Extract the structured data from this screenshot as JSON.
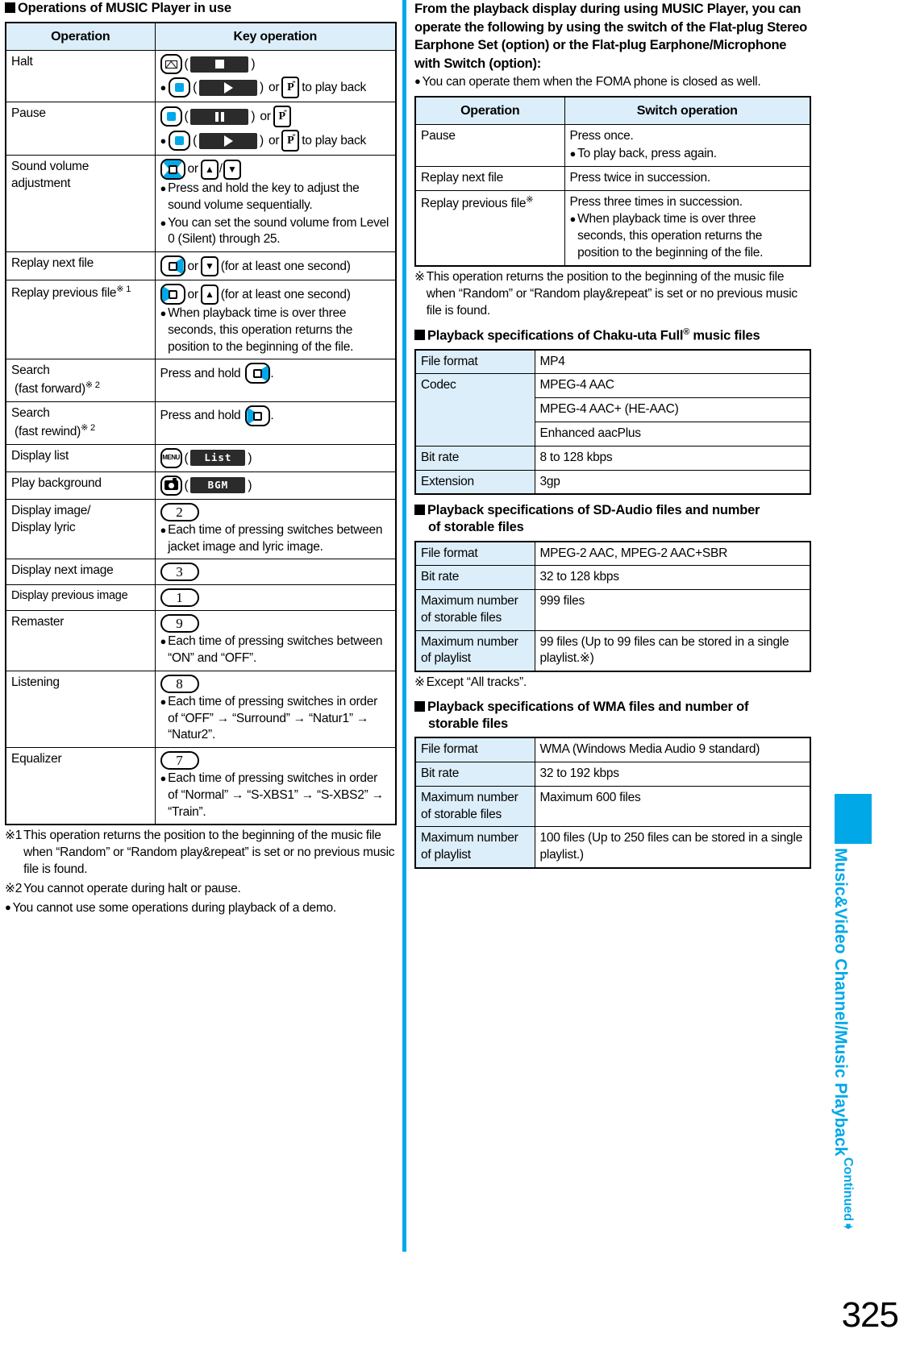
{
  "page": {
    "number": "325",
    "vertical_title": "Music&Video Channel/Music Playback",
    "continued_label": "Continued",
    "continued_arrow": "➧",
    "accent_color": "#00A8E8",
    "table_header_fill": "#DCEEF9"
  },
  "left": {
    "heading": "Operations of MUSIC Player in use",
    "table": {
      "headers": [
        "Operation",
        "Key operation"
      ],
      "rows": [
        {
          "operation": "Halt",
          "lines": [
            {
              "type": "keys",
              "items": [
                "key-mail",
                "paren-open",
                "chip-stop",
                "paren-close"
              ]
            },
            {
              "type": "keys-bullet",
              "items": [
                "dot",
                "key-center",
                "paren-open",
                "chip-play",
                "paren-close",
                "or",
                "key-p",
                "text-toplayback"
              ]
            }
          ],
          "text": {
            "or": "or",
            "to_play_back": "to play back"
          }
        },
        {
          "operation": "Pause",
          "lines": [
            {
              "type": "keys",
              "items": [
                "key-center",
                "paren-open",
                "chip-pause",
                "paren-close",
                "or",
                "key-p"
              ]
            },
            {
              "type": "keys-bullet",
              "items": [
                "dot",
                "key-center",
                "paren-open",
                "chip-play",
                "paren-close",
                "or",
                "key-p",
                "text-toplayback"
              ]
            }
          ],
          "text": {
            "or": "or",
            "to_play_back": "to play back"
          }
        },
        {
          "operation": "Sound volume adjustment",
          "keys_text": "or",
          "bullets": [
            "Press and hold the key to adjust the sound volume sequentially.",
            "You can set the sound volume from Level 0 (Silent) through 25."
          ]
        },
        {
          "operation": "Replay next file",
          "keys_text": "or",
          "suffix": "(for at least one second)"
        },
        {
          "operation": "Replay previous file",
          "marker": "※ 1",
          "keys_text": "or",
          "suffix": "(for at least one second)",
          "bullets": [
            "When playback time is over three seconds, this operation returns the position to the beginning of the file."
          ]
        },
        {
          "operation": "Search (fast forward)",
          "marker": "※ 2",
          "value_prefix": "Press and hold",
          "value_suffix": "."
        },
        {
          "operation": "Search (fast rewind)",
          "marker": "※ 2",
          "value_prefix": "Press and hold",
          "value_suffix": "."
        },
        {
          "operation": "Display list",
          "chip": "List"
        },
        {
          "operation": "Play background",
          "chip": "BGM"
        },
        {
          "operation": "Display image/ Display lyric",
          "numkey": "2",
          "bullets": [
            "Each time of pressing switches between jacket image and lyric image."
          ]
        },
        {
          "operation": "Display next image",
          "numkey": "3"
        },
        {
          "operation": "Display previous image",
          "numkey": "1"
        },
        {
          "operation": "Remaster",
          "numkey": "9",
          "bullets": [
            "Each time of pressing switches between “ON” and “OFF”."
          ]
        },
        {
          "operation": "Listening",
          "numkey": "8",
          "bullets": [
            "Each time of pressing switches in order of “OFF” → “Surround” → “Natur1” → “Natur2”."
          ]
        },
        {
          "operation": "Equalizer",
          "numkey": "7",
          "bullets": [
            "Each time of pressing switches in order of “Normal” → “S-XBS1” → “S-XBS2” → “Train”."
          ]
        }
      ]
    },
    "footnotes": [
      {
        "mark": "※1",
        "text": "This operation returns the position to the beginning of the music file when “Random” or “Random play&repeat” is set or no previous music file is found."
      },
      {
        "mark": "※2",
        "text": "You cannot operate during halt or pause."
      },
      {
        "mark": "●",
        "text": "You cannot use some operations during playback of a demo."
      }
    ]
  },
  "right": {
    "intro": "From the playback display during using MUSIC Player, you can operate the following by using the switch of the Flat-plug Stereo Earphone Set (option) or the Flat-plug Earphone/Microphone with Switch (option):",
    "intro_bullet": "You can operate them when the FOMA phone is closed as well.",
    "switch_table": {
      "headers": [
        "Operation",
        "Switch operation"
      ],
      "rows": [
        {
          "operation": "Pause",
          "marker": "",
          "value": "Press once.",
          "bullets": [
            "To play back, press again."
          ]
        },
        {
          "operation": "Replay next file",
          "marker": "",
          "value": "Press twice in succession.",
          "bullets": []
        },
        {
          "operation": "Replay previous file",
          "marker": "※",
          "value": "Press three times in succession.",
          "bullets": [
            "When playback time is over three seconds, this operation returns the position to the beginning of the file."
          ]
        }
      ]
    },
    "switch_footnote": {
      "mark": "※",
      "text": "This operation returns the position to the beginning of the music file when “Random” or “Random play&repeat” is set or no previous music file is found."
    },
    "chakuuta": {
      "heading_pre": "Playback specifications of Chaku-uta Full",
      "heading_sup": "®",
      "heading_post": " music files",
      "rows": [
        {
          "label": "File format",
          "values": [
            "MP4"
          ]
        },
        {
          "label": "Codec",
          "values": [
            "MPEG-4 AAC",
            "MPEG-4 AAC+ (HE-AAC)",
            "Enhanced aacPlus"
          ]
        },
        {
          "label": "Bit rate",
          "values": [
            "8 to 128 kbps"
          ]
        },
        {
          "label": "Extension",
          "values": [
            "3gp"
          ]
        }
      ]
    },
    "sdaudio": {
      "heading_line1": "Playback specifications of SD-Audio files and number",
      "heading_line2": "of storable files",
      "rows": [
        {
          "label": "File format",
          "value": "MPEG-2 AAC, MPEG-2 AAC+SBR"
        },
        {
          "label": "Bit rate",
          "value": "32 to 128 kbps"
        },
        {
          "label": "Maximum number of storable files",
          "value": "999 files"
        },
        {
          "label": "Maximum number of playlist",
          "value": "99 files (Up to 99 files can be stored in a single playlist.※)"
        }
      ],
      "footnote": {
        "mark": "※",
        "text": "Except “All tracks”."
      }
    },
    "wma": {
      "heading_line1": "Playback specifications of WMA files and number of",
      "heading_line2": "storable files",
      "rows": [
        {
          "label": "File format",
          "value": "WMA (Windows Media Audio 9 standard)"
        },
        {
          "label": "Bit rate",
          "value": "32 to 192 kbps"
        },
        {
          "label": "Maximum number of storable files",
          "value": "Maximum 600 files"
        },
        {
          "label": "Maximum number of playlist",
          "value": "100 files (Up to 250 files can be stored in a single playlist.)"
        }
      ]
    }
  }
}
